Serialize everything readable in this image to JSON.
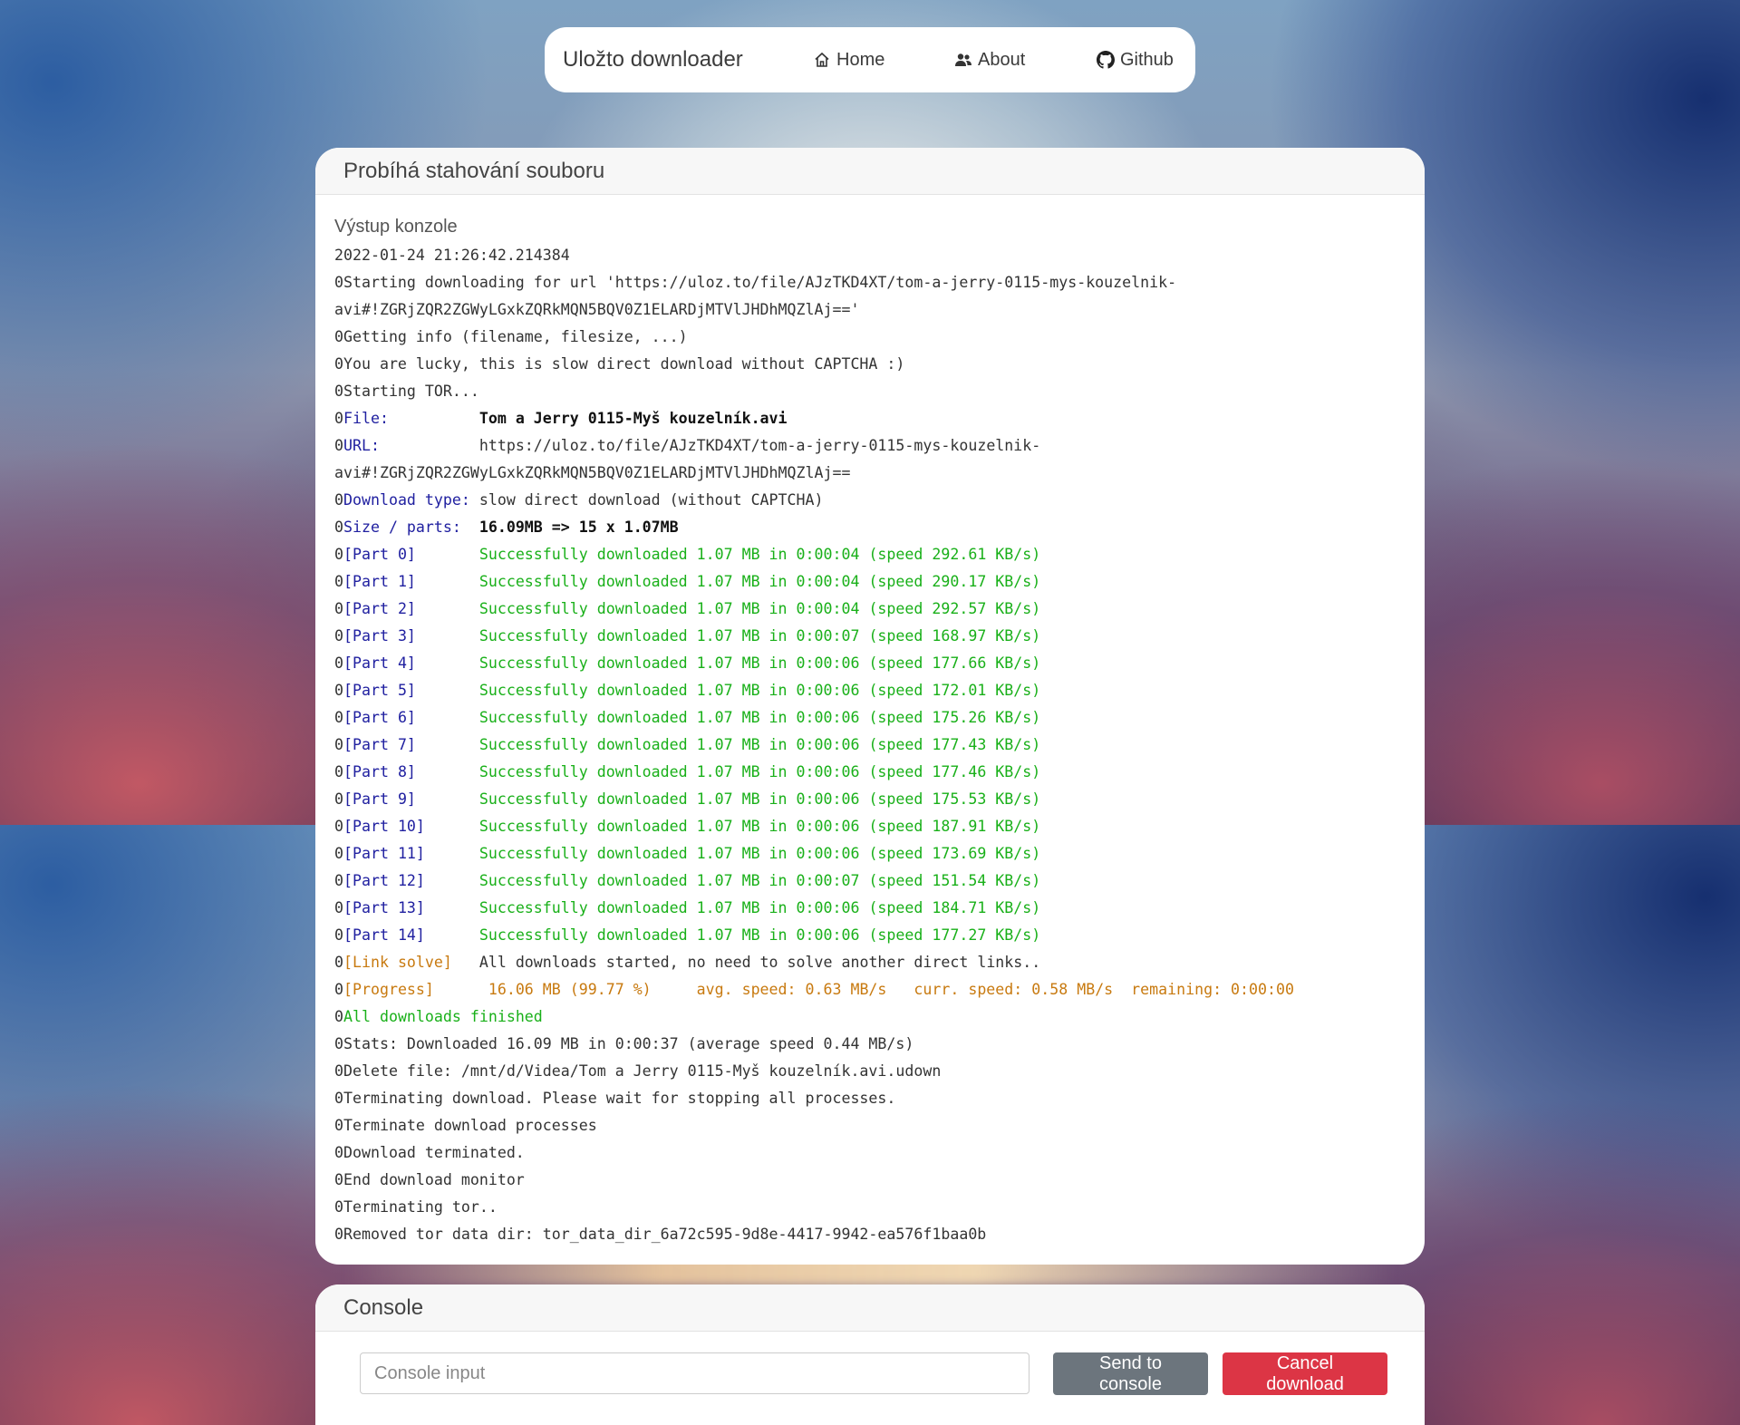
{
  "navbar": {
    "brand": "Uložto downloader",
    "items": [
      {
        "label": "Home",
        "icon": "home-icon"
      },
      {
        "label": "About",
        "icon": "users-icon"
      },
      {
        "label": "Github",
        "icon": "github-icon"
      }
    ]
  },
  "main_card": {
    "title": "Probíhá stahování souboru",
    "output_label": "Výstup konzole",
    "log": [
      [
        [
          "",
          "2022-01-24 21:26:42.214384"
        ]
      ],
      [
        [
          "",
          "0Starting downloading for url 'https://uloz.to/file/AJzTKD4XT/tom-a-jerry-0115-mys-kouzelnik-"
        ]
      ],
      [
        [
          "",
          "avi#!ZGRjZQR2ZGWyLGxkZQRkMQN5BQV0Z1ELARDjMTVlJHDhMQZlAj=='"
        ]
      ],
      [
        [
          "",
          "0Getting info (filename, filesize, ...)"
        ]
      ],
      [
        [
          "",
          "0You are lucky, this is slow direct download without CAPTCHA :)"
        ]
      ],
      [
        [
          "",
          "0Starting TOR..."
        ]
      ],
      [
        [
          "",
          "0"
        ],
        [
          "blue",
          "File:          "
        ],
        [
          "bold",
          "Tom a Jerry 0115-Myš kouzelník.avi"
        ]
      ],
      [
        [
          "",
          "0"
        ],
        [
          "blue",
          "URL:           "
        ],
        [
          "",
          "https://uloz.to/file/AJzTKD4XT/tom-a-jerry-0115-mys-kouzelnik-"
        ]
      ],
      [
        [
          "",
          "avi#!ZGRjZQR2ZGWyLGxkZQRkMQN5BQV0Z1ELARDjMTVlJHDhMQZlAj=="
        ]
      ],
      [
        [
          "",
          "0"
        ],
        [
          "blue",
          "Download type: "
        ],
        [
          "",
          "slow direct download (without CAPTCHA)"
        ]
      ],
      [
        [
          "",
          "0"
        ],
        [
          "blue",
          "Size / parts:  "
        ],
        [
          "bold",
          "16.09MB => 15 x 1.07MB"
        ]
      ],
      [
        [
          "",
          "0"
        ],
        [
          "blue",
          "[Part 0]       "
        ],
        [
          "green",
          "Successfully downloaded 1.07 MB in 0:00:04 (speed 292.61 KB/s)"
        ]
      ],
      [
        [
          "",
          "0"
        ],
        [
          "blue",
          "[Part 1]       "
        ],
        [
          "green",
          "Successfully downloaded 1.07 MB in 0:00:04 (speed 290.17 KB/s)"
        ]
      ],
      [
        [
          "",
          "0"
        ],
        [
          "blue",
          "[Part 2]       "
        ],
        [
          "green",
          "Successfully downloaded 1.07 MB in 0:00:04 (speed 292.57 KB/s)"
        ]
      ],
      [
        [
          "",
          "0"
        ],
        [
          "blue",
          "[Part 3]       "
        ],
        [
          "green",
          "Successfully downloaded 1.07 MB in 0:00:07 (speed 168.97 KB/s)"
        ]
      ],
      [
        [
          "",
          "0"
        ],
        [
          "blue",
          "[Part 4]       "
        ],
        [
          "green",
          "Successfully downloaded 1.07 MB in 0:00:06 (speed 177.66 KB/s)"
        ]
      ],
      [
        [
          "",
          "0"
        ],
        [
          "blue",
          "[Part 5]       "
        ],
        [
          "green",
          "Successfully downloaded 1.07 MB in 0:00:06 (speed 172.01 KB/s)"
        ]
      ],
      [
        [
          "",
          "0"
        ],
        [
          "blue",
          "[Part 6]       "
        ],
        [
          "green",
          "Successfully downloaded 1.07 MB in 0:00:06 (speed 175.26 KB/s)"
        ]
      ],
      [
        [
          "",
          "0"
        ],
        [
          "blue",
          "[Part 7]       "
        ],
        [
          "green",
          "Successfully downloaded 1.07 MB in 0:00:06 (speed 177.43 KB/s)"
        ]
      ],
      [
        [
          "",
          "0"
        ],
        [
          "blue",
          "[Part 8]       "
        ],
        [
          "green",
          "Successfully downloaded 1.07 MB in 0:00:06 (speed 177.46 KB/s)"
        ]
      ],
      [
        [
          "",
          "0"
        ],
        [
          "blue",
          "[Part 9]       "
        ],
        [
          "green",
          "Successfully downloaded 1.07 MB in 0:00:06 (speed 175.53 KB/s)"
        ]
      ],
      [
        [
          "",
          "0"
        ],
        [
          "blue",
          "[Part 10]      "
        ],
        [
          "green",
          "Successfully downloaded 1.07 MB in 0:00:06 (speed 187.91 KB/s)"
        ]
      ],
      [
        [
          "",
          "0"
        ],
        [
          "blue",
          "[Part 11]      "
        ],
        [
          "green",
          "Successfully downloaded 1.07 MB in 0:00:06 (speed 173.69 KB/s)"
        ]
      ],
      [
        [
          "",
          "0"
        ],
        [
          "blue",
          "[Part 12]      "
        ],
        [
          "green",
          "Successfully downloaded 1.07 MB in 0:00:07 (speed 151.54 KB/s)"
        ]
      ],
      [
        [
          "",
          "0"
        ],
        [
          "blue",
          "[Part 13]      "
        ],
        [
          "green",
          "Successfully downloaded 1.07 MB in 0:00:06 (speed 184.71 KB/s)"
        ]
      ],
      [
        [
          "",
          "0"
        ],
        [
          "blue",
          "[Part 14]      "
        ],
        [
          "green",
          "Successfully downloaded 1.07 MB in 0:00:06 (speed 177.27 KB/s)"
        ]
      ],
      [
        [
          "",
          "0"
        ],
        [
          "orange",
          "[Link solve]   "
        ],
        [
          "",
          "All downloads started, no need to solve another direct links.."
        ]
      ],
      [
        [
          "",
          "0"
        ],
        [
          "orange",
          "[Progress]      16.06 MB (99.77 %)     avg. speed: 0.63 MB/s   curr. speed: 0.58 MB/s  remaining: 0:00:00"
        ]
      ],
      [
        [
          "",
          "0"
        ],
        [
          "green",
          "All downloads finished"
        ]
      ],
      [
        [
          "",
          "0Stats: Downloaded 16.09 MB in 0:00:37 (average speed 0.44 MB/s)"
        ]
      ],
      [
        [
          "",
          "0Delete file: /mnt/d/Videa/Tom a Jerry 0115-Myš kouzelník.avi.udown"
        ]
      ],
      [
        [
          "",
          "0Terminating download. Please wait for stopping all processes."
        ]
      ],
      [
        [
          "",
          "0Terminate download processes"
        ]
      ],
      [
        [
          "",
          "0Download terminated."
        ]
      ],
      [
        [
          "",
          "0End download monitor"
        ]
      ],
      [
        [
          "",
          "0Terminating tor.."
        ]
      ],
      [
        [
          "",
          "0Removed tor data dir: tor_data_dir_6a72c595-9d8e-4417-9942-ea576f1baa0b"
        ]
      ]
    ]
  },
  "console_card": {
    "title": "Console",
    "input_placeholder": "Console input",
    "input_value": "",
    "send_label": "Send to console",
    "cancel_label": "Cancel download"
  },
  "colors": {
    "log_blue": "#2020a0",
    "log_green": "#19b019",
    "log_orange": "#c87a10",
    "send_button": "#6c757d",
    "cancel_button": "#dc3545"
  }
}
